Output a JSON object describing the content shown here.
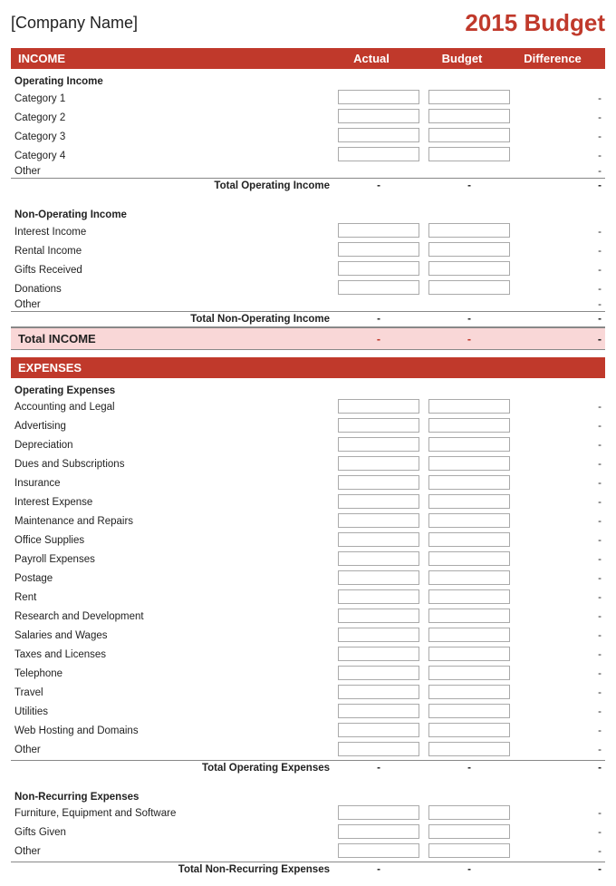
{
  "header": {
    "company": "[Company Name]",
    "title": "2015 Budget"
  },
  "income": {
    "section_label": "INCOME",
    "col_actual": "Actual",
    "col_budget": "Budget",
    "col_diff": "Difference",
    "operating": {
      "label": "Operating Income",
      "items": [
        "Category 1",
        "Category 2",
        "Category 3",
        "Category 4",
        "Other"
      ],
      "total_label": "Total Operating Income",
      "total_actual": "-",
      "total_budget": "-",
      "total_diff": "-"
    },
    "non_operating": {
      "label": "Non-Operating Income",
      "items": [
        "Interest Income",
        "Rental Income",
        "Gifts Received",
        "Donations",
        "Other"
      ],
      "total_label": "Total Non-Operating Income",
      "total_actual": "-",
      "total_budget": "-",
      "total_diff": "-"
    },
    "total_label": "Total INCOME",
    "total_actual": "-",
    "total_budget": "-",
    "total_diff": "-"
  },
  "expenses": {
    "section_label": "EXPENSES",
    "operating": {
      "label": "Operating Expenses",
      "items": [
        "Accounting and Legal",
        "Advertising",
        "Depreciation",
        "Dues and Subscriptions",
        "Insurance",
        "Interest Expense",
        "Maintenance and Repairs",
        "Office Supplies",
        "Payroll Expenses",
        "Postage",
        "Rent",
        "Research and Development",
        "Salaries and Wages",
        "Taxes and Licenses",
        "Telephone",
        "Travel",
        "Utilities",
        "Web Hosting and Domains",
        "Other"
      ],
      "total_label": "Total Operating Expenses",
      "total_actual": "-",
      "total_budget": "-",
      "total_diff": "-"
    },
    "non_recurring": {
      "label": "Non-Recurring Expenses",
      "items": [
        "Furniture, Equipment and Software",
        "Gifts Given",
        "Other"
      ],
      "total_label": "Total Non-Recurring Expenses",
      "total_actual": "-",
      "total_budget": "-",
      "total_diff": "-"
    }
  },
  "dash": "-"
}
